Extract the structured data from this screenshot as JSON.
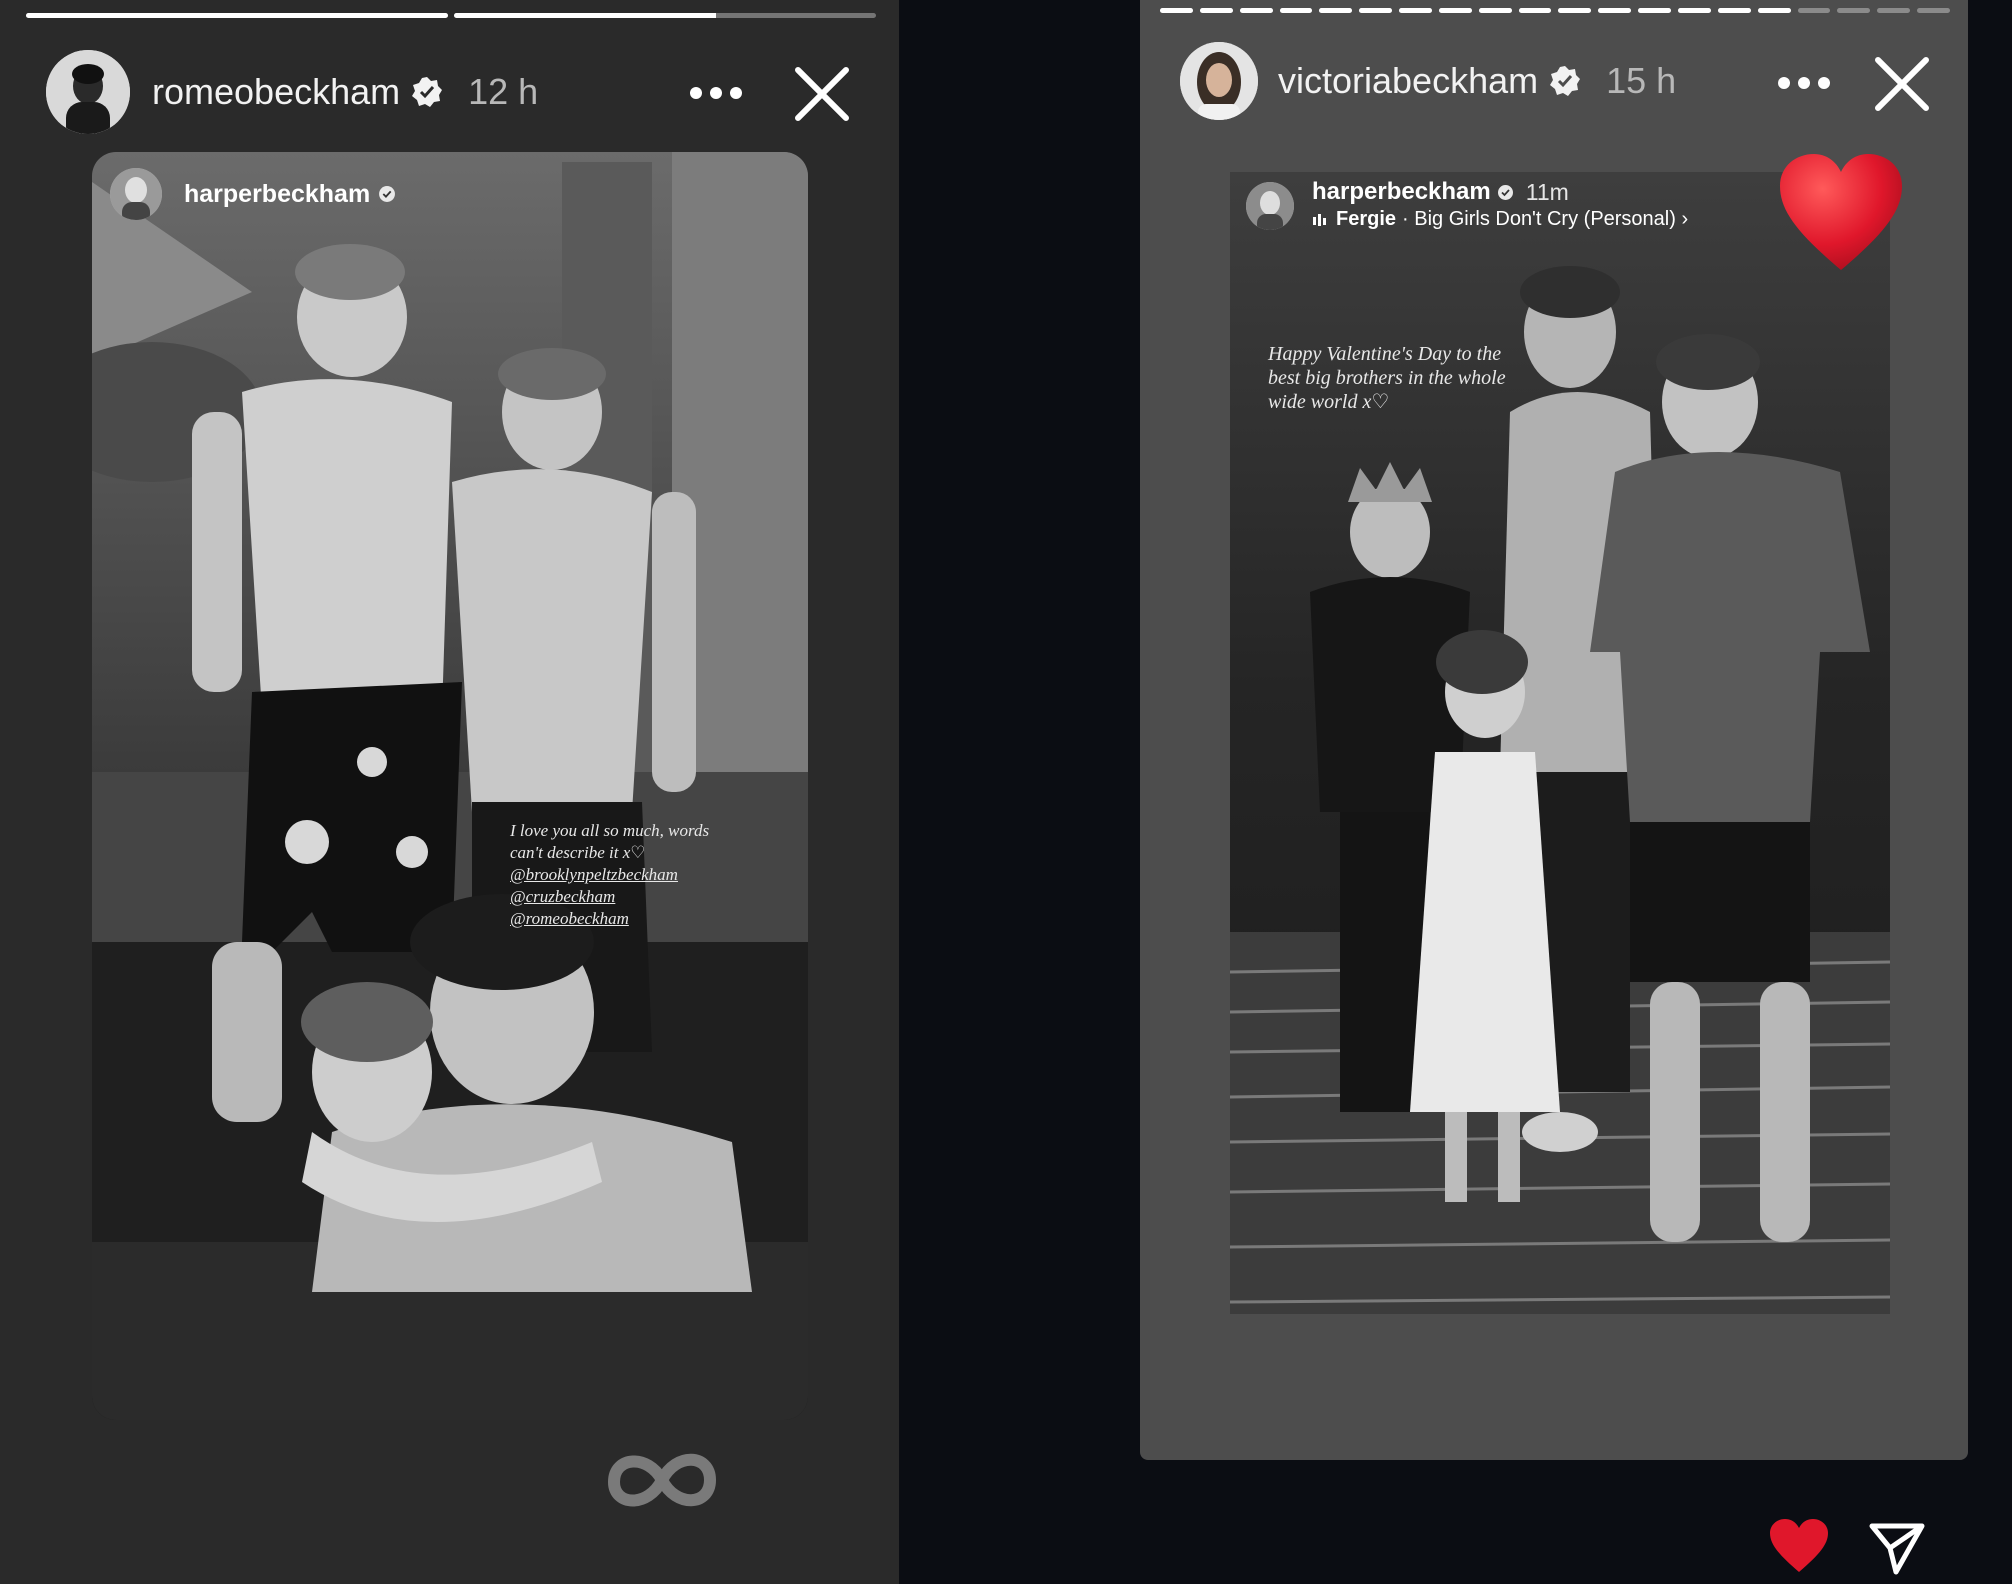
{
  "left_story": {
    "progress": [
      1.0,
      0.62
    ],
    "user": {
      "username": "romeobeckham",
      "time": "12 h"
    },
    "reshare": {
      "username": "harperbeckham",
      "caption_lines": [
        "I love you all so much, words",
        "can't describe it x♡",
        "@brooklynpeltzbeckham",
        "@cruzbeckham",
        "@romeobeckham"
      ]
    },
    "footer_icon": "boomerang-icon"
  },
  "right_story": {
    "progress": [
      1,
      1,
      1,
      1,
      1,
      1,
      1,
      1,
      1,
      1,
      1,
      1,
      1,
      1,
      1,
      1,
      0,
      0,
      0,
      0
    ],
    "user": {
      "username": "victoriabeckham",
      "time": "15 h"
    },
    "reshare": {
      "username": "harperbeckham",
      "time": "11m",
      "music_artist": "Fergie",
      "music_title": "· Big Girls Don't Cry (Personal) ›",
      "caption_lines": [
        "Happy Valentine's Day to the",
        "best big brothers in the whole",
        "wide world x♡"
      ]
    },
    "sticker": "heart-icon",
    "actions": [
      "heart-icon",
      "send-icon"
    ]
  },
  "colors": {
    "panel_left": "#2a2a2a",
    "panel_right": "#4d4d4d",
    "background": "#0b0d13",
    "heart": "#e0172b"
  }
}
